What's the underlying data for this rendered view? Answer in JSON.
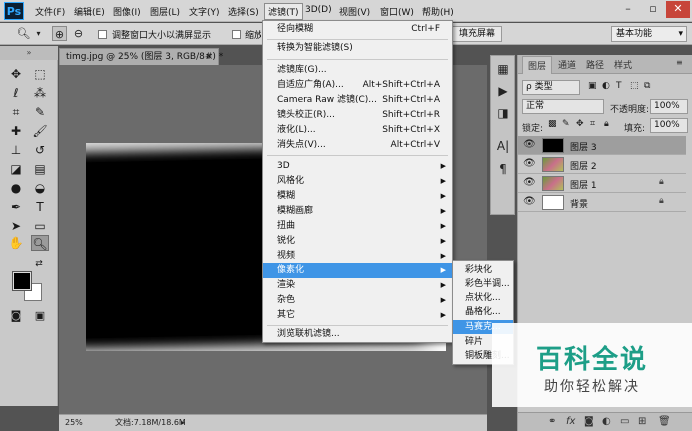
{
  "app": {
    "logo": "Ps"
  },
  "menubar": {
    "items": [
      {
        "label": "文件(F)"
      },
      {
        "label": "编辑(E)"
      },
      {
        "label": "图像(I)"
      },
      {
        "label": "图层(L)"
      },
      {
        "label": "文字(Y)"
      },
      {
        "label": "选择(S)"
      },
      {
        "label": "滤镜(T)"
      },
      {
        "label": "3D(D)"
      },
      {
        "label": "视图(V)"
      },
      {
        "label": "窗口(W)"
      },
      {
        "label": "帮助(H)"
      }
    ],
    "active_index": 6
  },
  "options": {
    "resize_windows_label": "调整窗口大小以满屏显示",
    "zoom_all_label": "缩放所有",
    "fill_screen_label": "填充屏幕",
    "workspace": "基本功能"
  },
  "document": {
    "tab_title": "timg.jpg @ 25% (图层 3, RGB/8#) *",
    "zoom": "25%",
    "doc_size": "文档:7.18M/18.6M"
  },
  "filter_menu": {
    "group1": [
      {
        "label": "径向模糊",
        "shortcut": "Ctrl+F"
      }
    ],
    "group2": [
      {
        "label": "转换为智能滤镜(S)"
      }
    ],
    "group3": [
      {
        "label": "滤镜库(G)..."
      },
      {
        "label": "自适应广角(A)...",
        "shortcut": "Alt+Shift+Ctrl+A"
      },
      {
        "label": "Camera Raw 滤镜(C)...",
        "shortcut": "Shift+Ctrl+A"
      },
      {
        "label": "镜头校正(R)...",
        "shortcut": "Shift+Ctrl+R"
      },
      {
        "label": "液化(L)...",
        "shortcut": "Shift+Ctrl+X"
      },
      {
        "label": "消失点(V)...",
        "shortcut": "Alt+Ctrl+V"
      }
    ],
    "group4": [
      {
        "label": "3D"
      },
      {
        "label": "风格化"
      },
      {
        "label": "模糊"
      },
      {
        "label": "模糊画廊"
      },
      {
        "label": "扭曲"
      },
      {
        "label": "锐化"
      },
      {
        "label": "视频"
      },
      {
        "label": "像素化"
      },
      {
        "label": "渲染"
      },
      {
        "label": "杂色"
      },
      {
        "label": "其它"
      }
    ],
    "highlighted": "像素化",
    "group5": [
      {
        "label": "浏览联机滤镜..."
      }
    ]
  },
  "pixelate_submenu": {
    "items": [
      {
        "label": "彩块化"
      },
      {
        "label": "彩色半调..."
      },
      {
        "label": "点状化..."
      },
      {
        "label": "晶格化..."
      },
      {
        "label": "马赛克..."
      },
      {
        "label": "碎片"
      },
      {
        "label": "铜板雕刻..."
      }
    ],
    "highlighted": "马赛克..."
  },
  "layers_panel": {
    "tabs": [
      {
        "label": "图层"
      },
      {
        "label": "通道"
      },
      {
        "label": "路径"
      },
      {
        "label": "样式"
      }
    ],
    "filter_kind": "ρ 类型",
    "blend_mode": "正常",
    "opacity_label": "不透明度:",
    "opacity_value": "100%",
    "lock_label": "锁定:",
    "fill_label": "填充:",
    "fill_value": "100%",
    "layers": [
      {
        "name": "图层 3",
        "thumb": "black",
        "selected": true,
        "locked": false
      },
      {
        "name": "图层 2",
        "thumb": "photo",
        "selected": false,
        "locked": false
      },
      {
        "name": "图层 1",
        "thumb": "photo",
        "selected": false,
        "locked": true
      },
      {
        "name": "背景",
        "thumb": "white",
        "selected": false,
        "locked": true
      }
    ]
  },
  "watermark": {
    "title": "百科全说",
    "subtitle": "助你轻松解决"
  },
  "colors": {
    "menu_highlight": "#3f95e6",
    "watermark_green": "#1d9e87"
  }
}
